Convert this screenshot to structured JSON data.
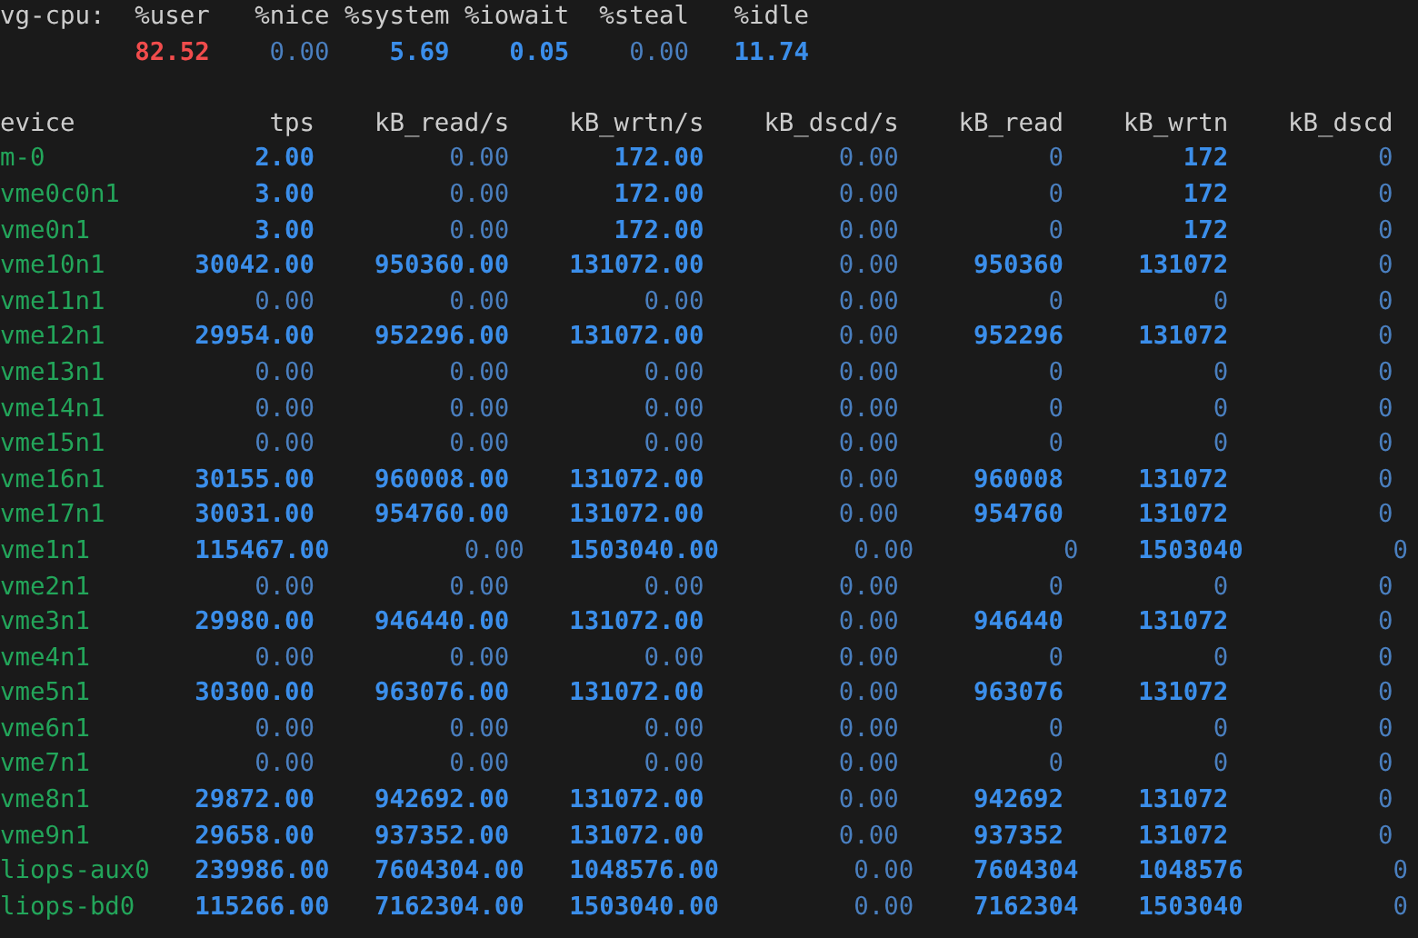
{
  "cpu": {
    "label": "vg-cpu:",
    "headers": [
      "%user",
      "%nice",
      "%system",
      "%iowait",
      "%steal",
      "%idle"
    ],
    "values": [
      {
        "text": "82.52",
        "highlighted": true,
        "alert": true
      },
      {
        "text": "0.00",
        "highlighted": false,
        "alert": false
      },
      {
        "text": "5.69",
        "highlighted": true,
        "alert": false
      },
      {
        "text": "0.05",
        "highlighted": true,
        "alert": false
      },
      {
        "text": "0.00",
        "highlighted": false,
        "alert": false
      },
      {
        "text": "11.74",
        "highlighted": true,
        "alert": false
      }
    ]
  },
  "devices": {
    "columns": [
      "evice",
      "tps",
      "kB_read/s",
      "kB_wrtn/s",
      "kB_dscd/s",
      "kB_read",
      "kB_wrtn",
      "kB_dscd"
    ],
    "rows": [
      {
        "device": "m-0",
        "values": [
          {
            "text": "2.00",
            "highlighted": true
          },
          {
            "text": "0.00",
            "highlighted": false
          },
          {
            "text": "172.00",
            "highlighted": true
          },
          {
            "text": "0.00",
            "highlighted": false
          },
          {
            "text": "0",
            "highlighted": false
          },
          {
            "text": "172",
            "highlighted": true
          },
          {
            "text": "0",
            "highlighted": false
          }
        ]
      },
      {
        "device": "vme0c0n1",
        "values": [
          {
            "text": "3.00",
            "highlighted": true
          },
          {
            "text": "0.00",
            "highlighted": false
          },
          {
            "text": "172.00",
            "highlighted": true
          },
          {
            "text": "0.00",
            "highlighted": false
          },
          {
            "text": "0",
            "highlighted": false
          },
          {
            "text": "172",
            "highlighted": true
          },
          {
            "text": "0",
            "highlighted": false
          }
        ]
      },
      {
        "device": "vme0n1",
        "values": [
          {
            "text": "3.00",
            "highlighted": true
          },
          {
            "text": "0.00",
            "highlighted": false
          },
          {
            "text": "172.00",
            "highlighted": true
          },
          {
            "text": "0.00",
            "highlighted": false
          },
          {
            "text": "0",
            "highlighted": false
          },
          {
            "text": "172",
            "highlighted": true
          },
          {
            "text": "0",
            "highlighted": false
          }
        ]
      },
      {
        "device": "vme10n1",
        "values": [
          {
            "text": "30042.00",
            "highlighted": true
          },
          {
            "text": "950360.00",
            "highlighted": true
          },
          {
            "text": "131072.00",
            "highlighted": true
          },
          {
            "text": "0.00",
            "highlighted": false
          },
          {
            "text": "950360",
            "highlighted": true
          },
          {
            "text": "131072",
            "highlighted": true
          },
          {
            "text": "0",
            "highlighted": false
          }
        ]
      },
      {
        "device": "vme11n1",
        "values": [
          {
            "text": "0.00",
            "highlighted": false
          },
          {
            "text": "0.00",
            "highlighted": false
          },
          {
            "text": "0.00",
            "highlighted": false
          },
          {
            "text": "0.00",
            "highlighted": false
          },
          {
            "text": "0",
            "highlighted": false
          },
          {
            "text": "0",
            "highlighted": false
          },
          {
            "text": "0",
            "highlighted": false
          }
        ]
      },
      {
        "device": "vme12n1",
        "values": [
          {
            "text": "29954.00",
            "highlighted": true
          },
          {
            "text": "952296.00",
            "highlighted": true
          },
          {
            "text": "131072.00",
            "highlighted": true
          },
          {
            "text": "0.00",
            "highlighted": false
          },
          {
            "text": "952296",
            "highlighted": true
          },
          {
            "text": "131072",
            "highlighted": true
          },
          {
            "text": "0",
            "highlighted": false
          }
        ]
      },
      {
        "device": "vme13n1",
        "values": [
          {
            "text": "0.00",
            "highlighted": false
          },
          {
            "text": "0.00",
            "highlighted": false
          },
          {
            "text": "0.00",
            "highlighted": false
          },
          {
            "text": "0.00",
            "highlighted": false
          },
          {
            "text": "0",
            "highlighted": false
          },
          {
            "text": "0",
            "highlighted": false
          },
          {
            "text": "0",
            "highlighted": false
          }
        ]
      },
      {
        "device": "vme14n1",
        "values": [
          {
            "text": "0.00",
            "highlighted": false
          },
          {
            "text": "0.00",
            "highlighted": false
          },
          {
            "text": "0.00",
            "highlighted": false
          },
          {
            "text": "0.00",
            "highlighted": false
          },
          {
            "text": "0",
            "highlighted": false
          },
          {
            "text": "0",
            "highlighted": false
          },
          {
            "text": "0",
            "highlighted": false
          }
        ]
      },
      {
        "device": "vme15n1",
        "values": [
          {
            "text": "0.00",
            "highlighted": false
          },
          {
            "text": "0.00",
            "highlighted": false
          },
          {
            "text": "0.00",
            "highlighted": false
          },
          {
            "text": "0.00",
            "highlighted": false
          },
          {
            "text": "0",
            "highlighted": false
          },
          {
            "text": "0",
            "highlighted": false
          },
          {
            "text": "0",
            "highlighted": false
          }
        ]
      },
      {
        "device": "vme16n1",
        "values": [
          {
            "text": "30155.00",
            "highlighted": true
          },
          {
            "text": "960008.00",
            "highlighted": true
          },
          {
            "text": "131072.00",
            "highlighted": true
          },
          {
            "text": "0.00",
            "highlighted": false
          },
          {
            "text": "960008",
            "highlighted": true
          },
          {
            "text": "131072",
            "highlighted": true
          },
          {
            "text": "0",
            "highlighted": false
          }
        ]
      },
      {
        "device": "vme17n1",
        "values": [
          {
            "text": "30031.00",
            "highlighted": true
          },
          {
            "text": "954760.00",
            "highlighted": true
          },
          {
            "text": "131072.00",
            "highlighted": true
          },
          {
            "text": "0.00",
            "highlighted": false
          },
          {
            "text": "954760",
            "highlighted": true
          },
          {
            "text": "131072",
            "highlighted": true
          },
          {
            "text": "0",
            "highlighted": false
          }
        ]
      },
      {
        "device": "vme1n1",
        "values": [
          {
            "text": "115467.00",
            "highlighted": true
          },
          {
            "text": "0.00",
            "highlighted": false
          },
          {
            "text": "1503040.00",
            "highlighted": true
          },
          {
            "text": "0.00",
            "highlighted": false
          },
          {
            "text": "0",
            "highlighted": false
          },
          {
            "text": "1503040",
            "highlighted": true
          },
          {
            "text": "0",
            "highlighted": false
          }
        ]
      },
      {
        "device": "vme2n1",
        "values": [
          {
            "text": "0.00",
            "highlighted": false
          },
          {
            "text": "0.00",
            "highlighted": false
          },
          {
            "text": "0.00",
            "highlighted": false
          },
          {
            "text": "0.00",
            "highlighted": false
          },
          {
            "text": "0",
            "highlighted": false
          },
          {
            "text": "0",
            "highlighted": false
          },
          {
            "text": "0",
            "highlighted": false
          }
        ]
      },
      {
        "device": "vme3n1",
        "values": [
          {
            "text": "29980.00",
            "highlighted": true
          },
          {
            "text": "946440.00",
            "highlighted": true
          },
          {
            "text": "131072.00",
            "highlighted": true
          },
          {
            "text": "0.00",
            "highlighted": false
          },
          {
            "text": "946440",
            "highlighted": true
          },
          {
            "text": "131072",
            "highlighted": true
          },
          {
            "text": "0",
            "highlighted": false
          }
        ]
      },
      {
        "device": "vme4n1",
        "values": [
          {
            "text": "0.00",
            "highlighted": false
          },
          {
            "text": "0.00",
            "highlighted": false
          },
          {
            "text": "0.00",
            "highlighted": false
          },
          {
            "text": "0.00",
            "highlighted": false
          },
          {
            "text": "0",
            "highlighted": false
          },
          {
            "text": "0",
            "highlighted": false
          },
          {
            "text": "0",
            "highlighted": false
          }
        ]
      },
      {
        "device": "vme5n1",
        "values": [
          {
            "text": "30300.00",
            "highlighted": true
          },
          {
            "text": "963076.00",
            "highlighted": true
          },
          {
            "text": "131072.00",
            "highlighted": true
          },
          {
            "text": "0.00",
            "highlighted": false
          },
          {
            "text": "963076",
            "highlighted": true
          },
          {
            "text": "131072",
            "highlighted": true
          },
          {
            "text": "0",
            "highlighted": false
          }
        ]
      },
      {
        "device": "vme6n1",
        "values": [
          {
            "text": "0.00",
            "highlighted": false
          },
          {
            "text": "0.00",
            "highlighted": false
          },
          {
            "text": "0.00",
            "highlighted": false
          },
          {
            "text": "0.00",
            "highlighted": false
          },
          {
            "text": "0",
            "highlighted": false
          },
          {
            "text": "0",
            "highlighted": false
          },
          {
            "text": "0",
            "highlighted": false
          }
        ]
      },
      {
        "device": "vme7n1",
        "values": [
          {
            "text": "0.00",
            "highlighted": false
          },
          {
            "text": "0.00",
            "highlighted": false
          },
          {
            "text": "0.00",
            "highlighted": false
          },
          {
            "text": "0.00",
            "highlighted": false
          },
          {
            "text": "0",
            "highlighted": false
          },
          {
            "text": "0",
            "highlighted": false
          },
          {
            "text": "0",
            "highlighted": false
          }
        ]
      },
      {
        "device": "vme8n1",
        "values": [
          {
            "text": "29872.00",
            "highlighted": true
          },
          {
            "text": "942692.00",
            "highlighted": true
          },
          {
            "text": "131072.00",
            "highlighted": true
          },
          {
            "text": "0.00",
            "highlighted": false
          },
          {
            "text": "942692",
            "highlighted": true
          },
          {
            "text": "131072",
            "highlighted": true
          },
          {
            "text": "0",
            "highlighted": false
          }
        ]
      },
      {
        "device": "vme9n1",
        "values": [
          {
            "text": "29658.00",
            "highlighted": true
          },
          {
            "text": "937352.00",
            "highlighted": true
          },
          {
            "text": "131072.00",
            "highlighted": true
          },
          {
            "text": "0.00",
            "highlighted": false
          },
          {
            "text": "937352",
            "highlighted": true
          },
          {
            "text": "131072",
            "highlighted": true
          },
          {
            "text": "0",
            "highlighted": false
          }
        ]
      },
      {
        "device": "liops-aux0",
        "values": [
          {
            "text": "239986.00",
            "highlighted": true
          },
          {
            "text": "7604304.00",
            "highlighted": true
          },
          {
            "text": "1048576.00",
            "highlighted": true
          },
          {
            "text": "0.00",
            "highlighted": false
          },
          {
            "text": "7604304",
            "highlighted": true
          },
          {
            "text": "1048576",
            "highlighted": true
          },
          {
            "text": "0",
            "highlighted": false
          }
        ]
      },
      {
        "device": "liops-bd0",
        "values": [
          {
            "text": "115266.00",
            "highlighted": true
          },
          {
            "text": "7162304.00",
            "highlighted": true
          },
          {
            "text": "1503040.00",
            "highlighted": true
          },
          {
            "text": "0.00",
            "highlighted": false
          },
          {
            "text": "7162304",
            "highlighted": true
          },
          {
            "text": "1503040",
            "highlighted": true
          },
          {
            "text": "0",
            "highlighted": false
          }
        ]
      }
    ]
  }
}
